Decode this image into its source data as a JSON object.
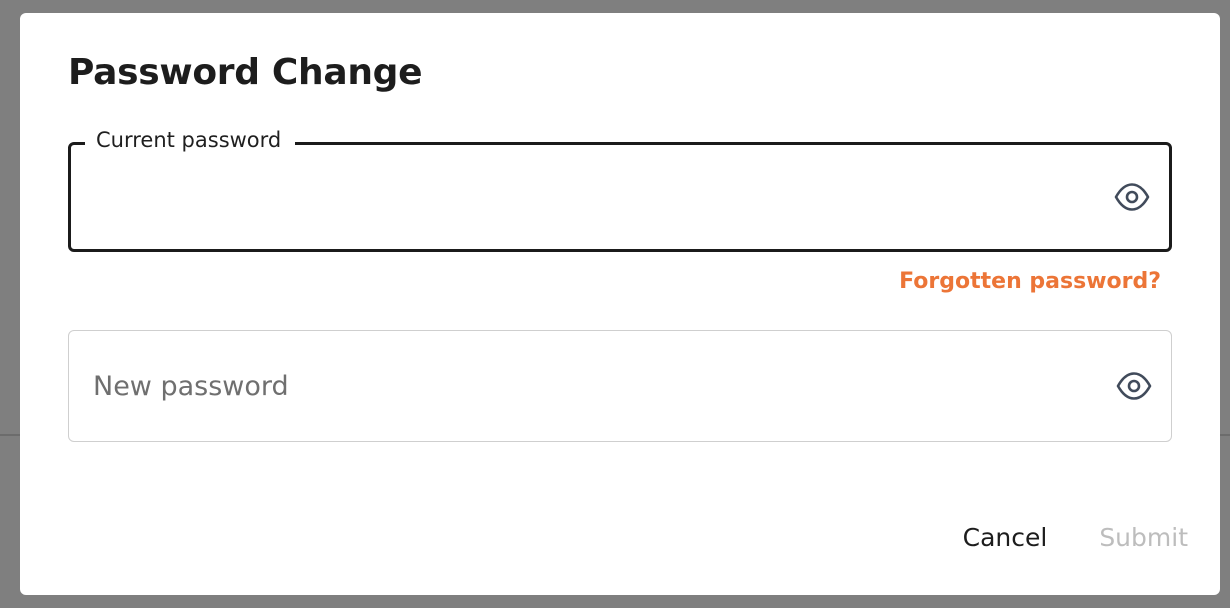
{
  "dialog": {
    "title": "Password Change",
    "current_password": {
      "label": "Current password",
      "value": "",
      "toggle_icon": "eye-icon"
    },
    "forgot_link": "Forgotten password?",
    "new_password": {
      "placeholder": "New password",
      "value": "",
      "toggle_icon": "eye-icon"
    },
    "actions": {
      "cancel_label": "Cancel",
      "submit_label": "Submit",
      "submit_enabled": false
    }
  },
  "colors": {
    "accent": "#ec7537",
    "focus_border": "#1b1b1b",
    "input_border": "#cfcfcf",
    "disabled_text": "#bdbdbd",
    "overlay": "#7f7f7f"
  }
}
